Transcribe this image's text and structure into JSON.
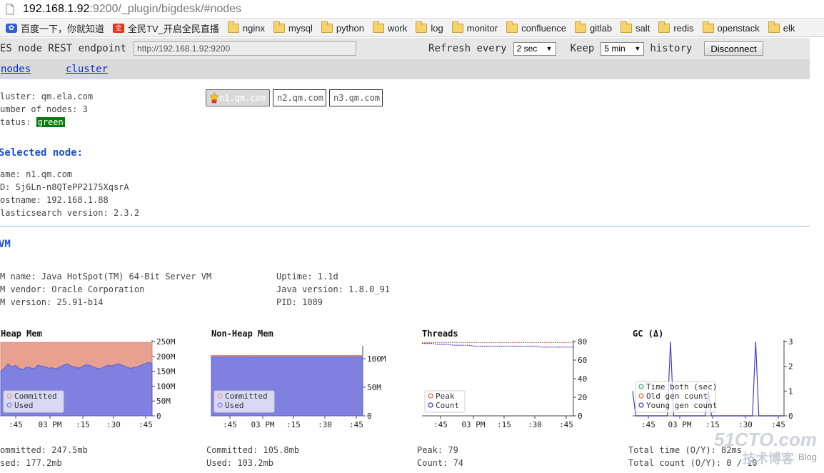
{
  "browser": {
    "url_host": "192.168.1.92",
    "url_path": ":9200/_plugin/bigdesk/#nodes",
    "bookmarks": [
      {
        "label": "百度一下，你就知道",
        "icon": "paw-icon"
      },
      {
        "label": "全民TV_开启全民直播",
        "icon": "tv-icon"
      },
      {
        "label": "nginx",
        "icon": "folder-icon"
      },
      {
        "label": "mysql",
        "icon": "folder-icon"
      },
      {
        "label": "python",
        "icon": "folder-icon"
      },
      {
        "label": "work",
        "icon": "folder-icon"
      },
      {
        "label": "log",
        "icon": "folder-icon"
      },
      {
        "label": "monitor",
        "icon": "folder-icon"
      },
      {
        "label": "confluence",
        "icon": "folder-icon"
      },
      {
        "label": "gitlab",
        "icon": "folder-icon"
      },
      {
        "label": "salt",
        "icon": "folder-icon"
      },
      {
        "label": "redis",
        "icon": "folder-icon"
      },
      {
        "label": "openstack",
        "icon": "folder-icon"
      },
      {
        "label": "elk",
        "icon": "folder-icon"
      }
    ]
  },
  "config": {
    "endpoint_label": "ES node REST endpoint",
    "endpoint_value": "http://192.168.1.92:9200",
    "refresh_label": "Refresh every",
    "refresh_value": "2 sec",
    "keep_label": "Keep",
    "keep_value": "5 min",
    "history_label": "history",
    "disconnect_label": "Disconnect"
  },
  "tabs": {
    "nodes": "nodes",
    "cluster": "cluster"
  },
  "cluster": {
    "name_line": "luster: qm.ela.com",
    "nodes_line": "umber of nodes: 3",
    "status_label": "tatus:",
    "status_value": "green",
    "status_color": "#0a7a0a",
    "node_buttons": [
      "n1.qm.com",
      "n2.qm.com",
      "n3.qm.com"
    ],
    "master_icon": "star-icon"
  },
  "selected_node": {
    "heading": "Selected node:",
    "name_line": "ame: n1.qm.com",
    "id_line": "D: Sj6Ln-n8QTePP2175XqsrA",
    "host_line": "ostname: 192.168.1.88",
    "version_line": "lasticsearch version: 2.3.2"
  },
  "jvm": {
    "heading": "VM",
    "left": [
      "M name: Java HotSpot(TM) 64-Bit Server VM",
      "M vendor: Oracle Corporation",
      "M version: 25.91-b14"
    ],
    "right": [
      "Uptime: 1.1d",
      "Java version: 1.8.0_91",
      "PID: 1089"
    ]
  },
  "chart_data": [
    {
      "type": "area",
      "title": "Heap Mem",
      "x_ticks": [
        ":45",
        "03 PM",
        ":15",
        ":30",
        ":45"
      ],
      "y_ticks": [
        "0",
        "50M",
        "100M",
        "150M",
        "200M",
        "250M"
      ],
      "ylim": [
        0,
        250
      ],
      "series": [
        {
          "name": "Committed",
          "color": "#e8a090",
          "values": [
            247,
            247,
            247,
            247,
            247,
            247,
            247,
            247,
            247,
            247,
            247,
            247,
            247,
            247,
            247,
            247,
            247,
            247,
            247,
            247,
            247,
            247,
            247,
            247,
            247,
            247,
            247,
            247,
            247,
            247,
            247,
            247,
            247,
            247,
            247,
            247,
            247,
            247,
            247,
            247,
            247,
            247
          ]
        },
        {
          "name": "Used",
          "color": "#8080e0",
          "values": [
            150,
            160,
            175,
            165,
            170,
            160,
            155,
            165,
            162,
            158,
            170,
            168,
            165,
            160,
            162,
            158,
            165,
            170,
            175,
            168,
            165,
            160,
            165,
            172,
            170,
            165,
            160,
            158,
            165,
            170,
            168,
            172,
            175,
            170,
            165,
            160,
            162,
            165,
            170,
            175,
            180,
            177
          ]
        }
      ],
      "footer": [
        "ommitted: 247.5mb",
        "sed: 177.2mb"
      ]
    },
    {
      "type": "area",
      "title": "Non-Heap Mem",
      "x_ticks": [
        ":45",
        "03 PM",
        ":15",
        ":30",
        ":45"
      ],
      "y_ticks": [
        "0",
        "50M",
        "100M"
      ],
      "ylim": [
        0,
        120
      ],
      "series": [
        {
          "name": "Committed",
          "color": "#e8a090",
          "values": [
            105.8,
            105.8,
            105.8,
            105.8,
            105.8,
            105.8,
            105.8,
            105.8,
            105.8,
            105.8,
            105.8,
            105.8,
            105.8,
            105.8,
            105.8,
            105.8,
            105.8,
            105.8,
            105.8,
            105.8
          ]
        },
        {
          "name": "Used",
          "color": "#8080e0",
          "values": [
            103.1,
            103.1,
            103.1,
            103.1,
            103.1,
            103.1,
            103.2,
            103.2,
            103.2,
            103.2,
            103.2,
            103.2,
            103.2,
            103.2,
            103.2,
            103.2,
            103.2,
            103.2,
            103.2,
            103.2
          ]
        }
      ],
      "footer": [
        "Committed: 105.8mb",
        "Used: 103.2mb"
      ]
    },
    {
      "type": "line",
      "title": "Threads",
      "x_ticks": [
        ":45",
        "03 PM",
        ":15",
        ":30",
        ":45"
      ],
      "y_ticks": [
        "0",
        "20",
        "40",
        "60",
        "80"
      ],
      "ylim": [
        0,
        80
      ],
      "series": [
        {
          "name": "Peak",
          "color": "#e07050",
          "values": [
            79,
            79,
            79,
            79,
            79,
            79,
            79,
            79,
            79,
            79,
            79,
            79,
            79,
            79,
            79,
            79,
            79,
            79,
            79,
            79,
            79,
            79,
            79,
            79,
            79,
            79,
            79,
            79,
            79,
            79
          ]
        },
        {
          "name": "Count",
          "color": "#4040d0",
          "values": [
            78,
            78,
            78,
            77,
            77,
            77,
            76,
            76,
            76,
            76,
            75,
            75,
            75,
            75,
            75,
            75,
            75,
            75,
            75,
            75,
            75,
            75,
            75,
            74,
            74,
            74,
            74,
            74,
            74,
            74
          ]
        }
      ],
      "footer": [
        "Peak: 79",
        "Count: 74"
      ]
    },
    {
      "type": "line",
      "title": "GC (Δ)",
      "x_ticks": [
        ":45",
        "03 PM",
        ":15",
        ":30",
        ":45"
      ],
      "y_ticks": [
        "0",
        "1",
        "2",
        "3"
      ],
      "ylim": [
        0,
        3
      ],
      "series": [
        {
          "name": "Time both (sec)",
          "color": "#40b080",
          "values": [
            0,
            0,
            0,
            0,
            0,
            0,
            0,
            0,
            0,
            0,
            0,
            0,
            0,
            0,
            0,
            0,
            0,
            0,
            0,
            0,
            0,
            0,
            0,
            0,
            0,
            0,
            0,
            0,
            0,
            0
          ]
        },
        {
          "name": "Old gen count",
          "color": "#e07050",
          "values": [
            0,
            0,
            0,
            0,
            0,
            0,
            0,
            0,
            0,
            0,
            0,
            0,
            0,
            0,
            0,
            0,
            0,
            0,
            0,
            0,
            0,
            0,
            0,
            0,
            0,
            0,
            0,
            0,
            0,
            0
          ]
        },
        {
          "name": "Young gen count",
          "color": "#4040d0",
          "values": [
            1,
            0,
            0,
            0,
            0,
            0,
            0,
            0,
            0,
            0,
            0,
            0,
            3,
            0,
            0,
            0,
            0,
            0,
            0,
            0,
            0,
            0,
            0,
            0,
            1,
            0,
            0,
            0,
            0,
            0,
            0,
            0,
            0,
            0,
            0,
            0,
            0,
            0,
            0,
            3,
            0,
            0,
            0,
            0,
            0,
            0,
            0,
            0,
            0
          ]
        }
      ],
      "footer": [
        "Total time (O/Y): 82ms",
        "Total count (O/Y): 0 / 10"
      ]
    }
  ],
  "watermark": {
    "brand": "51CTO.com",
    "sub": "技术博客",
    "blog": "Blog"
  }
}
